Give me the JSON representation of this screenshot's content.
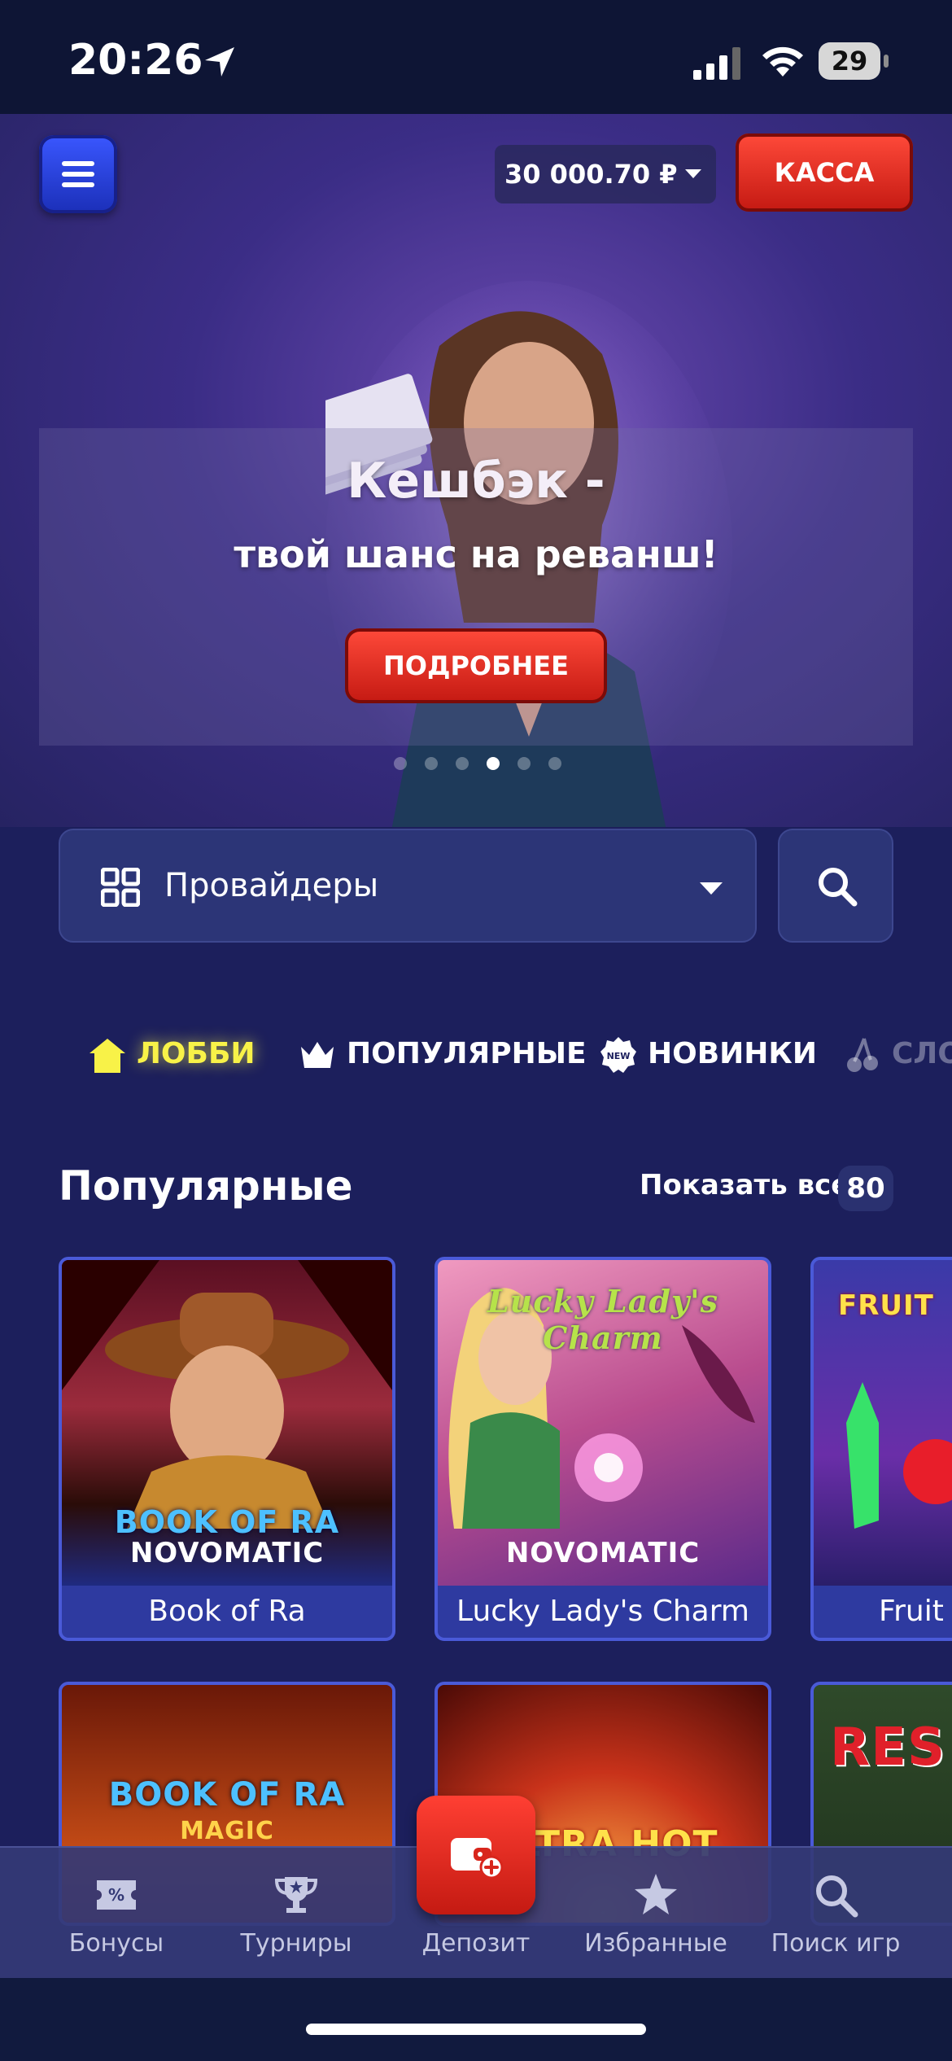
{
  "status_bar": {
    "time": "20:26",
    "battery": "29"
  },
  "header": {
    "balance": "30 000.70 ₽",
    "cashier_label": "КАССА"
  },
  "banner": {
    "title": "Кешбэк -",
    "subtitle": "твой шанс на реванш!",
    "button_label": "ПОДРОБНЕЕ",
    "slide_count": 6,
    "active_slide": 4
  },
  "providers": {
    "label": "Провайдеры"
  },
  "tabs": [
    {
      "label": "ЛОББИ",
      "icon": "home-icon",
      "active": true
    },
    {
      "label": "ПОПУЛЯРНЫЕ",
      "icon": "crown-icon",
      "active": false
    },
    {
      "label": "НОВИНКИ",
      "icon": "new-badge-icon",
      "active": false
    },
    {
      "label": "СЛО",
      "icon": "cherry-icon",
      "active": false
    }
  ],
  "popular": {
    "title": "Популярные",
    "show_all_label": "Показать все",
    "count": "80",
    "games": [
      {
        "name": "Book of Ra",
        "brand": "NOVOMATIC",
        "logo": "BOOK OF RA"
      },
      {
        "name": "Lucky Lady's Charm",
        "brand": "NOVOMATIC",
        "logo": "Lucky Lady's Charm"
      },
      {
        "name": "Fruit",
        "logo": "FRUIT"
      }
    ],
    "games_row2": [
      {
        "logo": "BOOK OF RA",
        "logo_sub": "MAGIC"
      },
      {
        "logo": "ULTRA HOT"
      },
      {
        "logo": "RES"
      }
    ]
  },
  "bottom_nav": [
    {
      "label": "Бонусы",
      "icon": "bonus-ticket-icon"
    },
    {
      "label": "Турниры",
      "icon": "trophy-icon"
    },
    {
      "label": "Депозит",
      "icon": "wallet-add-icon"
    },
    {
      "label": "Избранные",
      "icon": "star-icon"
    },
    {
      "label": "Поиск игр",
      "icon": "search-icon"
    }
  ],
  "colors": {
    "accent_red": "#d8261c",
    "accent_yellow": "#f8f248",
    "background": "#1c1f5c"
  }
}
